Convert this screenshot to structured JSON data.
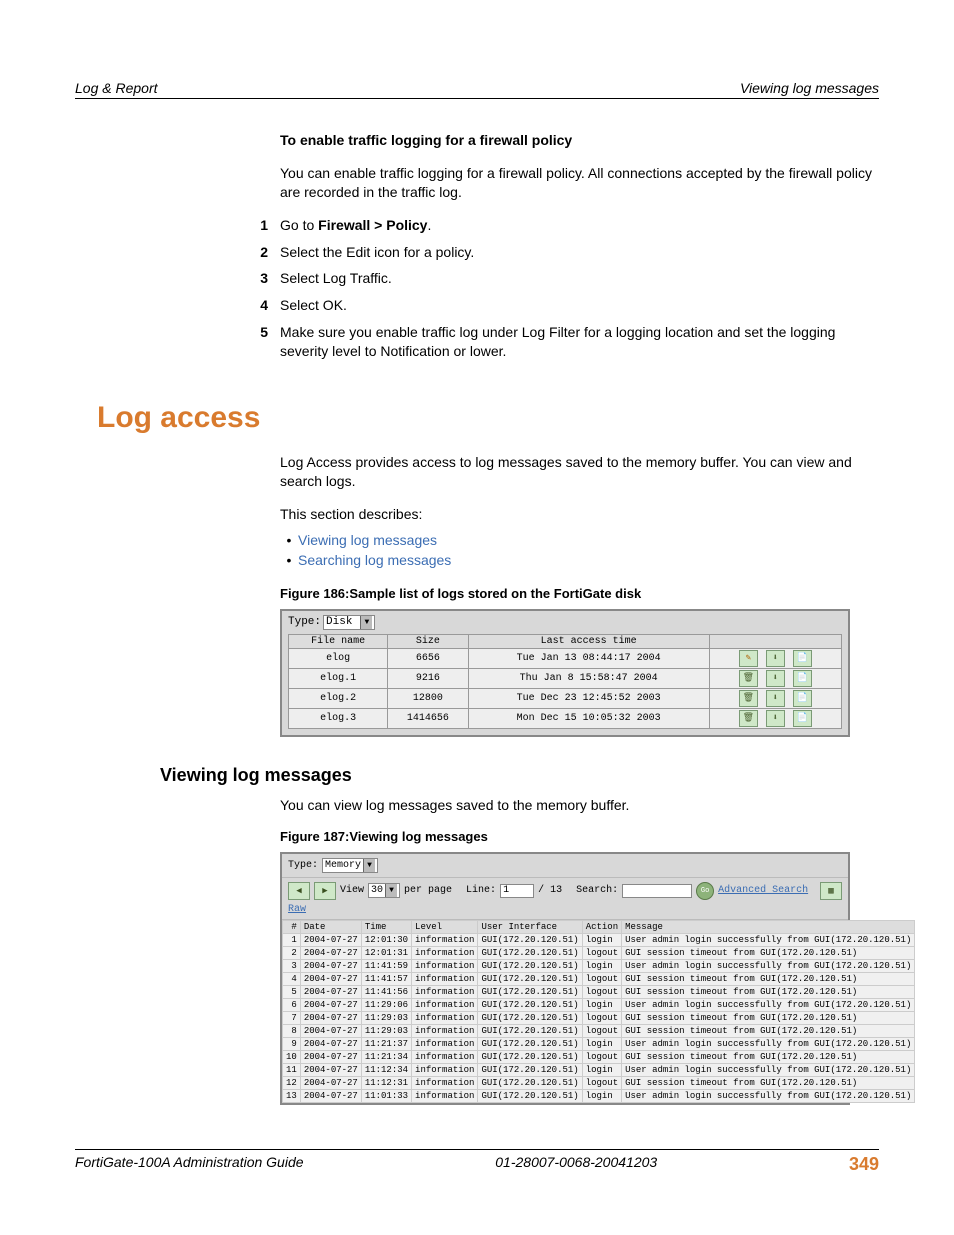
{
  "header": {
    "left": "Log & Report",
    "right": "Viewing log messages"
  },
  "subhead1": "To enable traffic logging for a firewall policy",
  "para1": "You can enable traffic logging for a firewall policy. All connections accepted by the firewall policy are recorded in the traffic log.",
  "steps": [
    {
      "n": "1",
      "prefix": "Go to ",
      "bold": "Firewall > Policy",
      "suffix": "."
    },
    {
      "n": "2",
      "text": "Select the Edit icon for a policy."
    },
    {
      "n": "3",
      "text": "Select Log Traffic."
    },
    {
      "n": "4",
      "text": "Select OK."
    },
    {
      "n": "5",
      "text": "Make sure you enable traffic log under Log Filter for a logging location and set the logging severity level to Notification or lower."
    }
  ],
  "section_title": "Log access",
  "para2": "Log Access provides access to log messages saved to the memory buffer. You can view and search logs.",
  "para3": "This section describes:",
  "bullets": [
    "Viewing log messages",
    "Searching log messages"
  ],
  "fig186": "Figure 186:Sample list of logs stored on the FortiGate disk",
  "disk": {
    "type_label": "Type:",
    "type_value": "Disk",
    "cols": [
      "File name",
      "Size",
      "Last access time",
      ""
    ],
    "rows": [
      {
        "name": "elog",
        "size": "6656",
        "time": "Tue Jan 13 08:44:17 2004",
        "icons": [
          "pen",
          "down",
          "doc"
        ]
      },
      {
        "name": "elog.1",
        "size": "9216",
        "time": "Thu Jan 8 15:58:47 2004",
        "icons": [
          "trash",
          "down",
          "doc"
        ]
      },
      {
        "name": "elog.2",
        "size": "12800",
        "time": "Tue Dec 23 12:45:52 2003",
        "icons": [
          "trash",
          "down",
          "doc"
        ]
      },
      {
        "name": "elog.3",
        "size": "1414656",
        "time": "Mon Dec 15 10:05:32 2003",
        "icons": [
          "trash",
          "down",
          "doc"
        ]
      }
    ]
  },
  "sub2": "Viewing log messages",
  "para4": "You can view log messages saved to the memory buffer.",
  "fig187": "Figure 187:Viewing log messages",
  "memory": {
    "type_label": "Type:",
    "type_value": "Memory",
    "view_label": "View",
    "view_value": "30",
    "per_page": "per page",
    "line_label": "Line:",
    "line_value": "1",
    "line_total": "/ 13",
    "search_label": "Search:",
    "go": "Go",
    "adv_search": "Advanced Search",
    "raw": "Raw",
    "cols": [
      "#",
      "Date",
      "Time",
      "Level",
      "User Interface",
      "Action",
      "Message"
    ],
    "rows": [
      {
        "n": "1",
        "d": "2004-07-27",
        "t": "12:01:30",
        "l": "information",
        "ui": "GUI(172.20.120.51)",
        "a": "login",
        "m": "User admin login successfully from GUI(172.20.120.51)"
      },
      {
        "n": "2",
        "d": "2004-07-27",
        "t": "12:01:31",
        "l": "information",
        "ui": "GUI(172.20.120.51)",
        "a": "logout",
        "m": "GUI session timeout from GUI(172.20.120.51)"
      },
      {
        "n": "3",
        "d": "2004-07-27",
        "t": "11:41:59",
        "l": "information",
        "ui": "GUI(172.20.120.51)",
        "a": "login",
        "m": "User admin login successfully from GUI(172.20.120.51)"
      },
      {
        "n": "4",
        "d": "2004-07-27",
        "t": "11:41:57",
        "l": "information",
        "ui": "GUI(172.20.120.51)",
        "a": "logout",
        "m": "GUI session timeout from GUI(172.20.120.51)"
      },
      {
        "n": "5",
        "d": "2004-07-27",
        "t": "11:41:56",
        "l": "information",
        "ui": "GUI(172.20.120.51)",
        "a": "logout",
        "m": "GUI session timeout from GUI(172.20.120.51)"
      },
      {
        "n": "6",
        "d": "2004-07-27",
        "t": "11:29:06",
        "l": "information",
        "ui": "GUI(172.20.120.51)",
        "a": "login",
        "m": "User admin login successfully from GUI(172.20.120.51)"
      },
      {
        "n": "7",
        "d": "2004-07-27",
        "t": "11:29:03",
        "l": "information",
        "ui": "GUI(172.20.120.51)",
        "a": "logout",
        "m": "GUI session timeout from GUI(172.20.120.51)"
      },
      {
        "n": "8",
        "d": "2004-07-27",
        "t": "11:29:03",
        "l": "information",
        "ui": "GUI(172.20.120.51)",
        "a": "logout",
        "m": "GUI session timeout from GUI(172.20.120.51)"
      },
      {
        "n": "9",
        "d": "2004-07-27",
        "t": "11:21:37",
        "l": "information",
        "ui": "GUI(172.20.120.51)",
        "a": "login",
        "m": "User admin login successfully from GUI(172.20.120.51)"
      },
      {
        "n": "10",
        "d": "2004-07-27",
        "t": "11:21:34",
        "l": "information",
        "ui": "GUI(172.20.120.51)",
        "a": "logout",
        "m": "GUI session timeout from GUI(172.20.120.51)"
      },
      {
        "n": "11",
        "d": "2004-07-27",
        "t": "11:12:34",
        "l": "information",
        "ui": "GUI(172.20.120.51)",
        "a": "login",
        "m": "User admin login successfully from GUI(172.20.120.51)"
      },
      {
        "n": "12",
        "d": "2004-07-27",
        "t": "11:12:31",
        "l": "information",
        "ui": "GUI(172.20.120.51)",
        "a": "logout",
        "m": "GUI session timeout from GUI(172.20.120.51)"
      },
      {
        "n": "13",
        "d": "2004-07-27",
        "t": "11:01:33",
        "l": "information",
        "ui": "GUI(172.20.120.51)",
        "a": "login",
        "m": "User admin login successfully from GUI(172.20.120.51)"
      }
    ]
  },
  "footer": {
    "left": "FortiGate-100A Administration Guide",
    "center": "01-28007-0068-20041203",
    "right": "349"
  }
}
